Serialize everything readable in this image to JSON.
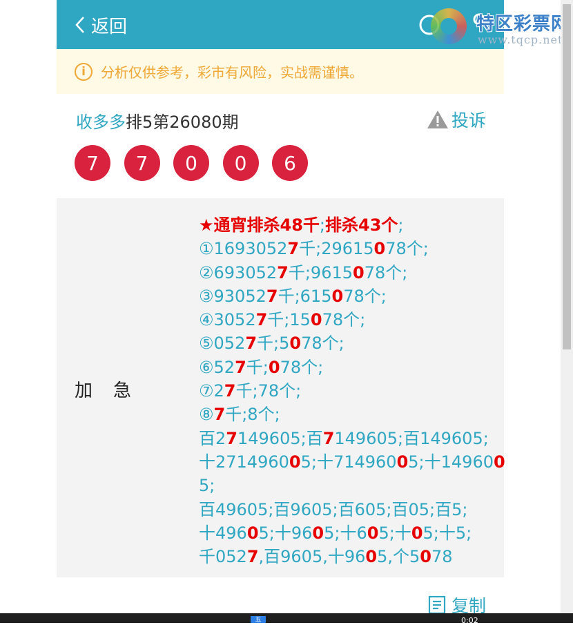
{
  "header": {
    "back_label": "返回",
    "watermark_name": "特区彩票网",
    "watermark_url": "www.tqcp.net"
  },
  "notice": {
    "icon": "info-icon",
    "text": "分析仅供参考，彩市有风险，实战需谨慎。"
  },
  "issue": {
    "source": "收多多",
    "title": "排5第26080期",
    "complain_label": "投诉"
  },
  "balls": [
    "7",
    "7",
    "0",
    "0",
    "6"
  ],
  "panel": {
    "label": "加急",
    "lines": [
      [
        {
          "t": "★通宵排杀48千",
          "r": true
        },
        {
          "t": ";"
        },
        {
          "t": "排杀43个",
          "r": true
        },
        {
          "t": ";"
        }
      ],
      [
        {
          "t": "①1693052"
        },
        {
          "t": "7",
          "r": true
        },
        {
          "t": "千;29615"
        },
        {
          "t": "0",
          "r": true
        },
        {
          "t": "78个;"
        }
      ],
      [
        {
          "t": "②693052"
        },
        {
          "t": "7",
          "r": true
        },
        {
          "t": "千;9615"
        },
        {
          "t": "0",
          "r": true
        },
        {
          "t": "78个;"
        }
      ],
      [
        {
          "t": "③93052"
        },
        {
          "t": "7",
          "r": true
        },
        {
          "t": "千;615"
        },
        {
          "t": "0",
          "r": true
        },
        {
          "t": "78个;"
        }
      ],
      [
        {
          "t": "④3052"
        },
        {
          "t": "7",
          "r": true
        },
        {
          "t": "千;15"
        },
        {
          "t": "0",
          "r": true
        },
        {
          "t": "78个;"
        }
      ],
      [
        {
          "t": "⑤052"
        },
        {
          "t": "7",
          "r": true
        },
        {
          "t": "千;5"
        },
        {
          "t": "0",
          "r": true
        },
        {
          "t": "78个;"
        }
      ],
      [
        {
          "t": "⑥52"
        },
        {
          "t": "7",
          "r": true
        },
        {
          "t": "千;"
        },
        {
          "t": "0",
          "r": true
        },
        {
          "t": "78个;"
        }
      ],
      [
        {
          "t": "⑦2"
        },
        {
          "t": "7",
          "r": true
        },
        {
          "t": "千;78个;"
        }
      ],
      [
        {
          "t": "⑧"
        },
        {
          "t": "7",
          "r": true
        },
        {
          "t": "千;8个;"
        }
      ],
      [
        {
          "t": "百2"
        },
        {
          "t": "7",
          "r": true
        },
        {
          "t": "149605;百"
        },
        {
          "t": "7",
          "r": true
        },
        {
          "t": "149605;百149605;"
        }
      ],
      [
        {
          "t": "十2714960"
        },
        {
          "t": "0",
          "r": true
        },
        {
          "t": "5;十714960"
        },
        {
          "t": "0",
          "r": true
        },
        {
          "t": "5;十14960"
        },
        {
          "t": "0",
          "r": true
        }
      ],
      [
        {
          "t": "5;"
        }
      ],
      [
        {
          "t": "百49605;百9605;百605;百05;百5;"
        }
      ],
      [
        {
          "t": "十496"
        },
        {
          "t": "0",
          "r": true
        },
        {
          "t": "5;十96"
        },
        {
          "t": "0",
          "r": true
        },
        {
          "t": "5;十6"
        },
        {
          "t": "0",
          "r": true
        },
        {
          "t": "5;十"
        },
        {
          "t": "0",
          "r": true
        },
        {
          "t": "5;十5;"
        }
      ],
      [
        {
          "t": "千052"
        },
        {
          "t": "7",
          "r": true
        },
        {
          "t": ",百9605,十96"
        },
        {
          "t": "0",
          "r": true
        },
        {
          "t": "5,个5"
        },
        {
          "t": "0",
          "r": true
        },
        {
          "t": "78"
        }
      ]
    ]
  },
  "actions": {
    "copy_label": "复制"
  },
  "taskbar": {
    "ime": "五",
    "clock": "0:02"
  },
  "colors": {
    "accent": "#2fa7c3",
    "ball": "#d9233e",
    "notice_text": "#f0a733",
    "notice_bg": "#fefae6",
    "highlight": "#e60000"
  }
}
